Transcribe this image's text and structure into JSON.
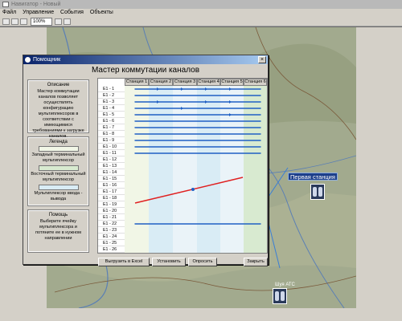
{
  "app": {
    "title": "Навигатор - Новый",
    "menu": [
      "Файл",
      "Управление",
      "События",
      "Объекты"
    ],
    "zoom": "100%"
  },
  "dialog": {
    "title": "Помощник",
    "close_label": "×",
    "header": "Мастер коммутации каналов",
    "description_panel": {
      "title": "Описание",
      "text": "Мастер коммутации каналов позволяет осуществлять конфигурацию мультиплексоров в соответствии с имеющимися требованиями к загрузке каналов."
    },
    "legend_panel": {
      "title": "Легенда",
      "items": [
        {
          "label": "Западный терминальный мультиплексор",
          "color": "#f1f6e6"
        },
        {
          "label": "Восточный терминальный мультиплексор",
          "color": "#d8ead0"
        },
        {
          "label": "Мультиплексор ввода - вывода",
          "color": "#d9ecf5"
        }
      ]
    },
    "help_panel": {
      "title": "Помощь",
      "text": "Выберите ячейку мультиплексора и потяните ее в нужном направлении"
    },
    "columns": [
      "Станция 1",
      "Станция 2",
      "Станция 3",
      "Станция 4",
      "Станция 5",
      "Станция 6"
    ],
    "rows": [
      "E1 - 1",
      "E1 - 2",
      "E1 - 3",
      "E1 - 4",
      "E1 - 5",
      "E1 - 6",
      "E1 - 7",
      "E1 - 8",
      "E1 - 9",
      "E1 - 10",
      "E1 - 11",
      "E1 - 12",
      "E1 - 13",
      "E1 - 14",
      "E1 - 15",
      "E1 - 16",
      "E1 - 17",
      "E1 - 18",
      "E1 - 19",
      "E1 - 20",
      "E1 - 21",
      "E1 - 22",
      "E1 - 23",
      "E1 - 24",
      "E1 - 25",
      "E1 - 26"
    ],
    "buttons": {
      "export": "Выгрузить в Excel",
      "install": "Установить",
      "poll": "Опросить",
      "close": "Закрыть"
    }
  },
  "map": {
    "station_label": "Первая станция",
    "node_label": "Шуя АТС"
  },
  "colors": {
    "link_blue": "#1f5fc4",
    "highlight_red": "#e02020",
    "titlebar": "#0a246a"
  }
}
